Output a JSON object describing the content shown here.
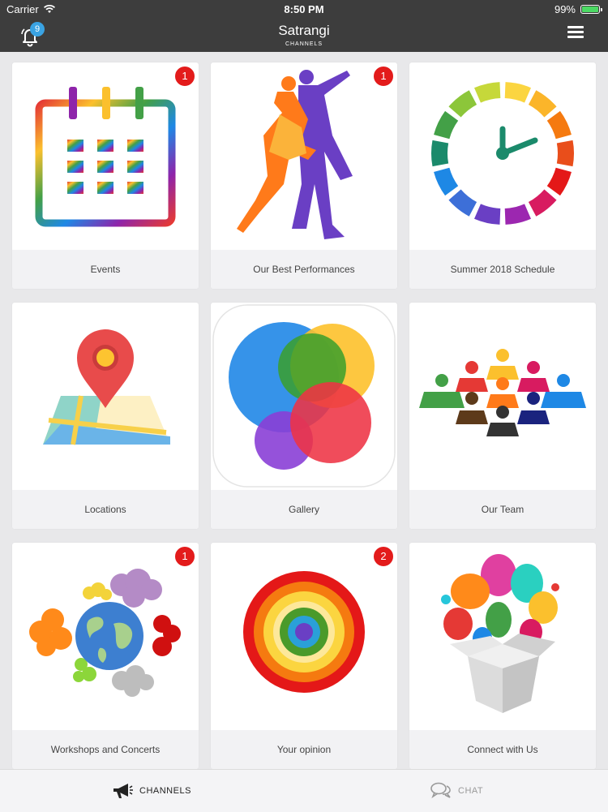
{
  "status": {
    "carrier": "Carrier",
    "time": "8:50 PM",
    "battery": "99%",
    "battery_level": 0.99
  },
  "header": {
    "title": "Satrangi",
    "subtitle": "CHANNELS",
    "notification_count": "9"
  },
  "tiles": [
    {
      "label": "Events",
      "badge": "1"
    },
    {
      "label": "Our Best Performances",
      "badge": "1"
    },
    {
      "label": "Summer 2018 Schedule",
      "badge": ""
    },
    {
      "label": "Locations",
      "badge": ""
    },
    {
      "label": "Gallery",
      "badge": ""
    },
    {
      "label": "Our Team",
      "badge": ""
    },
    {
      "label": "Workshops and Concerts",
      "badge": "1"
    },
    {
      "label": "Your opinion",
      "badge": "2"
    },
    {
      "label": "Connect with Us",
      "badge": ""
    }
  ],
  "tabs": {
    "channels": "CHANNELS",
    "chat": "CHAT"
  },
  "colors": {
    "bar": "#3d3d3d",
    "badge_red": "#e31b1b",
    "badge_blue": "#3aa3e3",
    "battery": "#4cd964"
  }
}
